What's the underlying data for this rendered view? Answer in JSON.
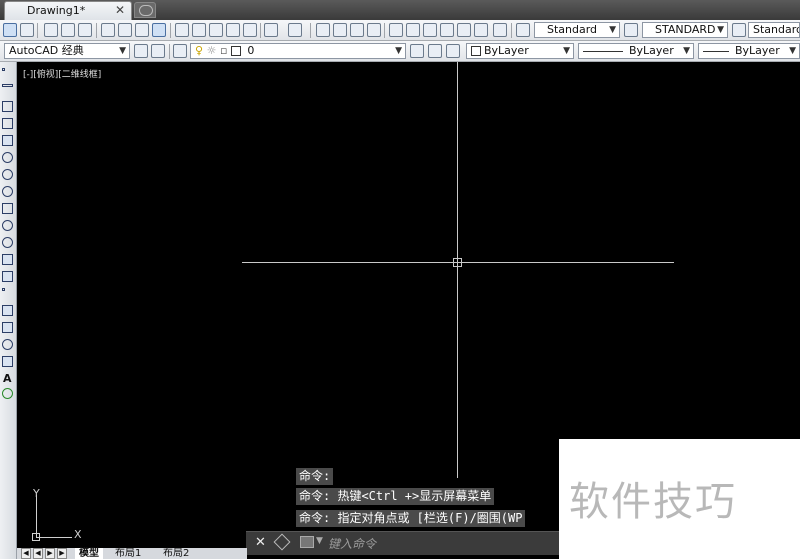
{
  "document_tab": {
    "title": "Drawing1*",
    "close": "✕"
  },
  "toolbar1": {
    "text_style": "Standard",
    "dim_style": "STANDARD",
    "table_style": "Standard"
  },
  "toolbar2": {
    "workspace": "AutoCAD 经典",
    "layer": "0",
    "color": "ByLayer",
    "linetype": "ByLayer",
    "lineweight": "ByLayer"
  },
  "viewport_label": "[-][俯视][二维线框]",
  "ucs": {
    "x": "X",
    "y": "Y"
  },
  "command_history": [
    "命令:",
    "命令: 热键<Ctrl +>显示屏幕菜单",
    "命令: 指定对角点或 [栏选(F)/圈围(WP"
  ],
  "command_line": {
    "placeholder": "键入命令"
  },
  "layout_tabs": {
    "model": "模型",
    "layout1": "布局1",
    "layout2": "布局2"
  },
  "watermark": "软件技巧",
  "colors": {
    "canvas": "#000000",
    "crosshair": "#c9c9c9",
    "command_bg": "#3b3b3b"
  }
}
